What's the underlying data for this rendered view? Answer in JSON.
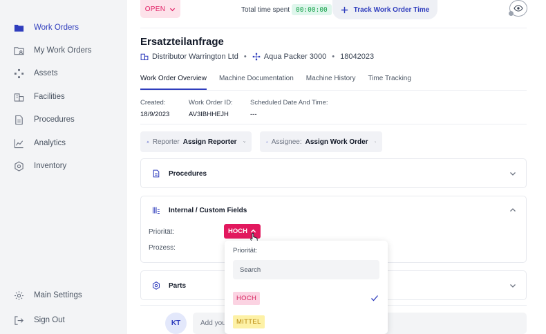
{
  "sidebar": {
    "items": [
      {
        "label": "Work Orders",
        "icon": "folder-icon"
      },
      {
        "label": "My Work Orders",
        "icon": "folder-user-icon"
      },
      {
        "label": "Assets",
        "icon": "assets-icon"
      },
      {
        "label": "Facilities",
        "icon": "building-icon"
      },
      {
        "label": "Procedures",
        "icon": "document-icon"
      },
      {
        "label": "Analytics",
        "icon": "chart-line-icon"
      },
      {
        "label": "Inventory",
        "icon": "gear-box-icon"
      }
    ],
    "bottom": [
      {
        "label": "Main Settings",
        "icon": "gear-icon"
      },
      {
        "label": "Sign Out",
        "icon": "sign-out-icon"
      }
    ],
    "active_color": "#2f3dbd"
  },
  "header": {
    "status": "OPEN",
    "time_label": "Total time spent",
    "time_value": "00:00:00",
    "track_button": "Track Work Order Time"
  },
  "work_order": {
    "title": "Ersatzteilanfrage",
    "customer": "Distributor Warrington Ltd",
    "machine": "Aqua Packer 3000",
    "serial": "18042023"
  },
  "tabs": [
    "Work Order Overview",
    "Machine Documentation",
    "Machine History",
    "Time Tracking"
  ],
  "info": {
    "created_label": "Created:",
    "created_value": "18/9/2023",
    "id_label": "Work Order ID:",
    "id_value": "AV3IBHHEJH",
    "scheduled_label": "Scheduled Date And Time:",
    "scheduled_value": "---"
  },
  "assign": {
    "reporter_label": "Reporter",
    "reporter_value": "Assign Reporter",
    "assignee_label": "Assignee:",
    "assignee_value": "Assign Work Order"
  },
  "sections": {
    "procedures": "Procedures",
    "custom_fields": "Internal / Custom Fields",
    "parts": "Parts"
  },
  "custom_fields": {
    "priority_label": "Priorität:",
    "priority_value": "HOCH",
    "process_label": "Prozess:"
  },
  "dropdown": {
    "label": "Priorität:",
    "search_placeholder": "Search",
    "options": [
      {
        "label": "HOCH",
        "bg": "#fbd3e2",
        "fg": "#d6245f",
        "selected": true
      },
      {
        "label": "MITTEL",
        "bg": "#fdf1a6",
        "fg": "#b8860b",
        "selected": false
      }
    ]
  },
  "comment": {
    "avatar": "KT",
    "placeholder": "Add you"
  },
  "colors": {
    "accent": "#2f3dbd",
    "open_status": "#e11d63",
    "priority_high": "#e2185e",
    "timer": "#16a34a"
  }
}
